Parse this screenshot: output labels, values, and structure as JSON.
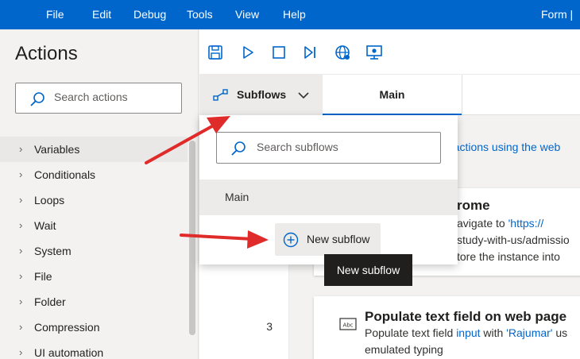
{
  "menubar": {
    "items": [
      "File",
      "Edit",
      "Debug",
      "Tools",
      "View",
      "Help"
    ],
    "form_title": "Form | "
  },
  "actions_pane": {
    "title": "Actions",
    "search_placeholder": "Search actions",
    "categories": [
      "Variables",
      "Conditionals",
      "Loops",
      "Wait",
      "System",
      "File",
      "Folder",
      "Compression",
      "UI automation"
    ]
  },
  "toolbar": {
    "icons": [
      "save-icon",
      "run-icon",
      "stop-icon",
      "next-action-icon",
      "web-recorder-icon",
      "desktop-recorder-icon"
    ]
  },
  "tabs": {
    "subflows_label": "Subflows",
    "main_label": "Main"
  },
  "canvas": {
    "hint_text": "d actions using the web",
    "line_numbers": [
      "3"
    ],
    "action1": {
      "title_fragment": "rome",
      "line1_prefix": "avigate to ",
      "line1_link": "'https://",
      "line2_link": "study-with-us/admissio",
      "line3": "tore the instance into"
    },
    "action2": {
      "title": "Populate text field on web page",
      "line1_prefix": "Populate text field ",
      "line1_link1": "input",
      "line1_mid": " with ",
      "line1_link2": "'Rajumar'",
      "line1_suffix": " us",
      "line2": "emulated typing",
      "icon_label": "Abc"
    }
  },
  "subflows_dropdown": {
    "search_placeholder": "Search subflows",
    "items": [
      "Main"
    ],
    "new_subflow_label": "New subflow"
  },
  "tooltip": {
    "text": "New subflow"
  },
  "colors": {
    "accent": "#0066cc",
    "arrow": "#e02b2b"
  }
}
